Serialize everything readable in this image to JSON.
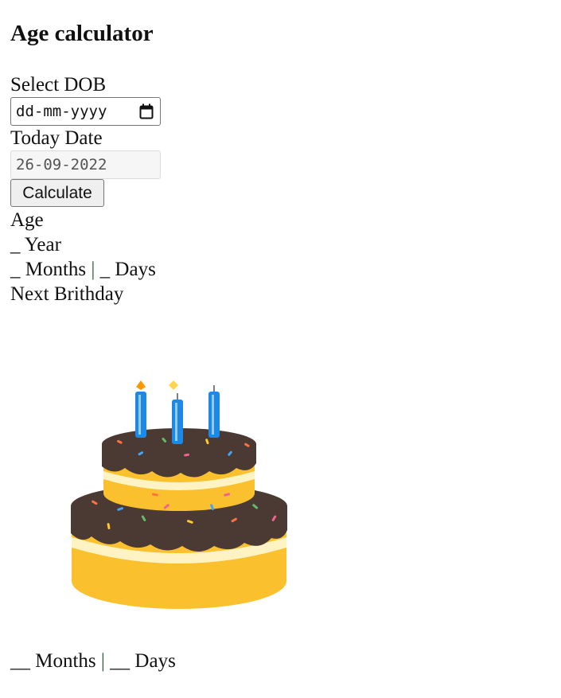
{
  "app": {
    "title": "Age calculator"
  },
  "dob": {
    "label": "Select DOB",
    "placeholder": "dd-mm-yyyy"
  },
  "today": {
    "label": "Today Date",
    "value": "26-09-2022"
  },
  "calculate_button": {
    "label": "Calculate"
  },
  "age": {
    "heading": "Age",
    "year_value": "_",
    "year_unit": "Year",
    "months_value": "_",
    "months_unit": "Months",
    "separator": "|",
    "days_value": "_",
    "days_unit": "Days"
  },
  "next_birthday": {
    "heading": "Next Brithday",
    "months_value": "__",
    "months_unit": "Months",
    "separator": "|",
    "days_value": "__",
    "days_unit": "Days"
  },
  "icons": {
    "dob_picker": "calendar-icon",
    "illustration": "birthday-cake-icon"
  },
  "colors": {
    "frosting": "#4a3a33",
    "cake": "#fbc02d",
    "cream": "#fff3c4",
    "candle": "#1e88e5",
    "separator": "#2c5a3a"
  }
}
